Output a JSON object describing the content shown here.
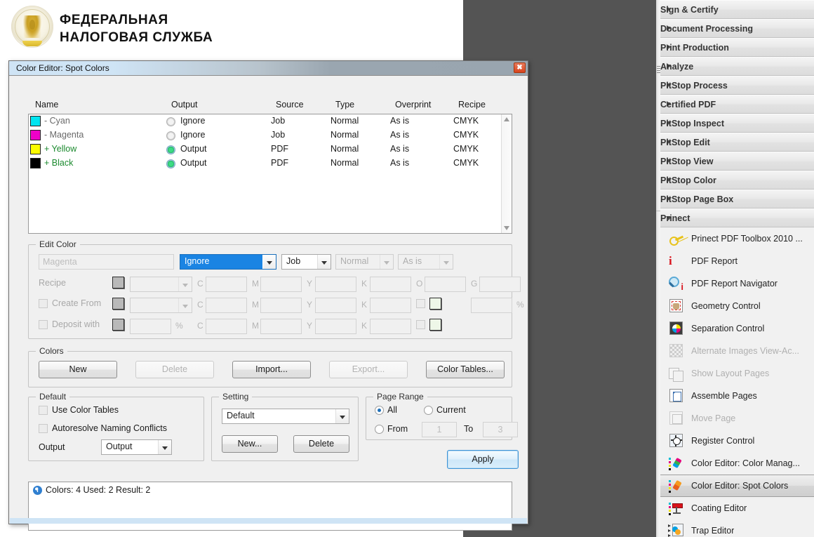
{
  "background": {
    "org_line1": "ФЕДЕРАЛЬНАЯ",
    "org_line2": "НАЛОГОВАЯ СЛУЖБА",
    "emblem_name": "russian-federal-tax-service-emblem"
  },
  "dialog": {
    "title": "Color Editor: Spot Colors",
    "close_label": "✖",
    "table": {
      "columns": [
        "Name",
        "Output",
        "Source",
        "Type",
        "Overprint",
        "Recipe"
      ],
      "rows": [
        {
          "swatch": "#00e5f0",
          "name": "- Cyan",
          "state": "removed",
          "output": "Ignore",
          "output_on": false,
          "source": "Job",
          "type": "Normal",
          "overprint": "As is",
          "recipe": "CMYK"
        },
        {
          "swatch": "#ef00c8",
          "name": "- Magenta",
          "state": "removed",
          "output": "Ignore",
          "output_on": false,
          "source": "Job",
          "type": "Normal",
          "overprint": "As is",
          "recipe": "CMYK"
        },
        {
          "swatch": "#fcfc00",
          "name": "+ Yellow",
          "state": "added",
          "output": "Output",
          "output_on": true,
          "source": "PDF",
          "type": "Normal",
          "overprint": "As is",
          "recipe": "CMYK"
        },
        {
          "swatch": "#000000",
          "name": "+ Black",
          "state": "added",
          "output": "Output",
          "output_on": true,
          "source": "PDF",
          "type": "Normal",
          "overprint": "As is",
          "recipe": "CMYK"
        }
      ]
    },
    "edit_color": {
      "legend": "Edit Color",
      "name_value": "Magenta",
      "action_value": "Ignore",
      "source_value": "Job",
      "type_value": "Normal",
      "overprint_value": "As is",
      "recipe_label": "Recipe",
      "create_from_label": "Create From",
      "deposit_with_label": "Deposit with",
      "channel_labels": [
        "C",
        "M",
        "Y",
        "K",
        "O",
        "G"
      ],
      "percent_label": "%"
    },
    "colors": {
      "legend": "Colors",
      "new_label": "New",
      "delete_label": "Delete",
      "import_label": "Import...",
      "export_label": "Export...",
      "color_tables_label": "Color Tables..."
    },
    "default": {
      "legend": "Default",
      "use_color_tables_label": "Use Color Tables",
      "autoresolve_label": "Autoresolve Naming Conflicts",
      "output_label": "Output",
      "output_value": "Output"
    },
    "setting": {
      "legend": "Setting",
      "value": "Default",
      "new_label": "New...",
      "delete_label": "Delete"
    },
    "page_range": {
      "legend": "Page Range",
      "all_label": "All",
      "current_label": "Current",
      "from_label": "From",
      "to_label": "To",
      "from_value": "1",
      "to_value": "3",
      "selected": "All"
    },
    "apply_label": "Apply",
    "status_text": "Colors: 4  Used: 2  Result: 2"
  },
  "right_panel": {
    "sections": [
      {
        "label": "Sign & Certify",
        "open": false
      },
      {
        "label": "Document Processing",
        "open": false
      },
      {
        "label": "Print Production",
        "open": false
      },
      {
        "label": "Analyze",
        "open": false
      },
      {
        "label": "PitStop Process",
        "open": false
      },
      {
        "label": "Certified PDF",
        "open": false
      },
      {
        "label": "PitStop Inspect",
        "open": false
      },
      {
        "label": "PitStop Edit",
        "open": false
      },
      {
        "label": "PitStop View",
        "open": false
      },
      {
        "label": "PitStop Color",
        "open": false
      },
      {
        "label": "PitStop Page Box",
        "open": false
      },
      {
        "label": "Prinect",
        "open": true
      }
    ],
    "tools": [
      {
        "label": "Prinect PDF Toolbox 2010 ...",
        "icon": "key-icon",
        "disabled": false,
        "selected": false
      },
      {
        "label": "PDF Report",
        "icon": "info-icon",
        "disabled": false,
        "selected": false
      },
      {
        "label": "PDF Report Navigator",
        "icon": "magnifier-info-icon",
        "disabled": false,
        "selected": false
      },
      {
        "label": "Geometry Control",
        "icon": "geometry-control-icon",
        "disabled": false,
        "selected": false
      },
      {
        "label": "Separation Control",
        "icon": "separation-control-icon",
        "disabled": false,
        "selected": false
      },
      {
        "label": "Alternate Images View-Ac...",
        "icon": "checkerboard-icon",
        "disabled": true,
        "selected": false
      },
      {
        "label": "Show Layout Pages",
        "icon": "layers-icon",
        "disabled": true,
        "selected": false
      },
      {
        "label": "Assemble Pages",
        "icon": "page-icon",
        "disabled": false,
        "selected": false
      },
      {
        "label": "Move Page",
        "icon": "move-page-icon",
        "disabled": true,
        "selected": false
      },
      {
        "label": "Register Control",
        "icon": "register-mark-icon",
        "disabled": false,
        "selected": false
      },
      {
        "label": "Color Editor: Color Manag...",
        "icon": "color-manage-pen-icon",
        "disabled": false,
        "selected": false
      },
      {
        "label": "Color Editor: Spot Colors",
        "icon": "spot-color-pen-icon",
        "disabled": false,
        "selected": true
      },
      {
        "label": "Coating Editor",
        "icon": "coating-roller-icon",
        "disabled": false,
        "selected": false
      },
      {
        "label": "Trap Editor",
        "icon": "trap-editor-icon",
        "disabled": false,
        "selected": false
      }
    ]
  }
}
